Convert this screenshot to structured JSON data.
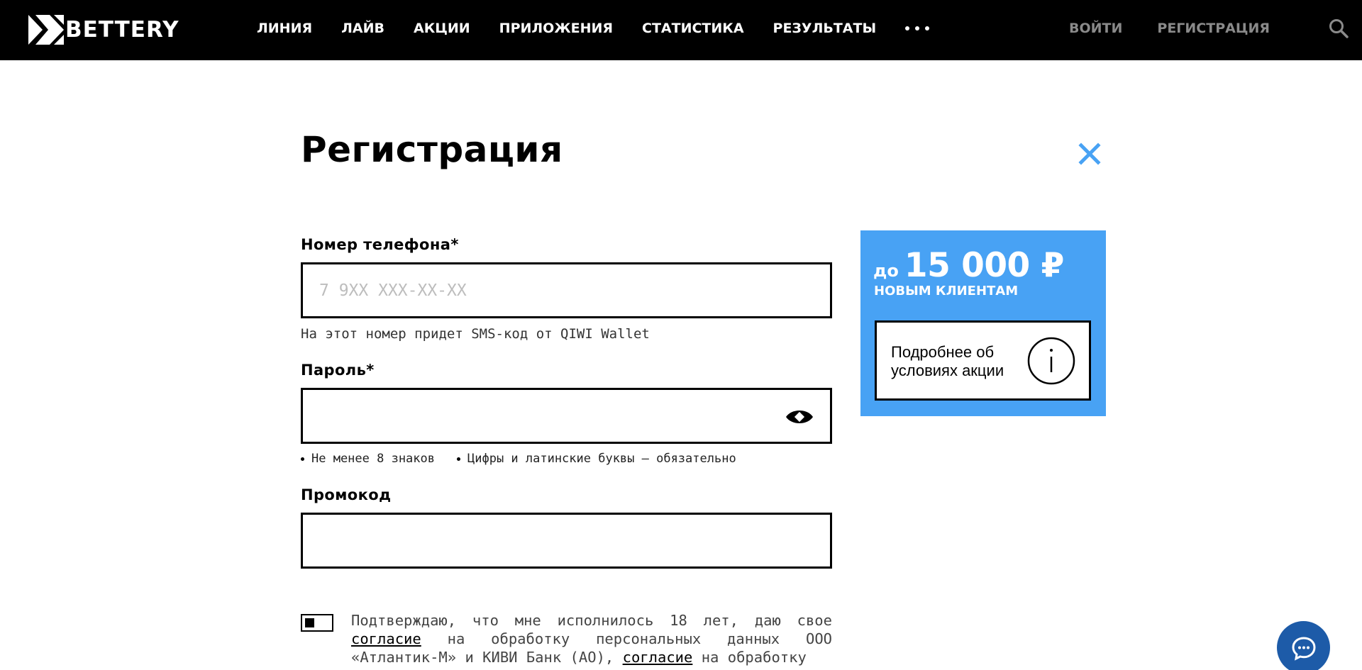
{
  "brand": {
    "name": "BETTERY"
  },
  "nav": {
    "items": [
      {
        "label": "ЛИНИЯ"
      },
      {
        "label": "ЛАЙВ"
      },
      {
        "label": "АКЦИИ"
      },
      {
        "label": "ПРИЛОЖЕНИЯ"
      },
      {
        "label": "СТАТИСТИКА"
      },
      {
        "label": "РЕЗУЛЬТАТЫ"
      }
    ],
    "more_icon": "more-dots-icon",
    "login": "ВОЙТИ",
    "register": "РЕГИСТРАЦИЯ",
    "search_icon": "search-icon"
  },
  "form": {
    "title": "Регистрация",
    "close_icon": "close-icon",
    "phone": {
      "label": "Номер телефона*",
      "placeholder": "7 9XX XXX-XX-XX",
      "value": "",
      "hint": "На этот номер придет SMS-код от QIWI Wallet"
    },
    "password": {
      "label": "Пароль*",
      "value": "",
      "rules": [
        "Не менее 8 знаков",
        "Цифры и латинские буквы – обязательно"
      ],
      "eye_icon": "eye-icon"
    },
    "promo": {
      "label": "Промокод",
      "value": ""
    },
    "consent": {
      "text_1": "Подтверждаю, что мне исполнилось 18 лет, даю свое ",
      "link_1": "согласие",
      "text_2": " на обработку персональных данных ООО «Атлантик-М» и КИВИ Банк (АО), ",
      "link_2": "согласие",
      "text_3": " на обработку"
    }
  },
  "promo_card": {
    "prefix": "до",
    "amount": "15 000 ₽",
    "subtitle": "НОВЫМ КЛИЕНТАМ",
    "more_label": "Подробнее об условиях акции",
    "info_icon": "info-icon"
  },
  "colors": {
    "accent": "#48a2f4",
    "topbar": "#000000",
    "chat": "#1d5ba8",
    "muted_link": "#8a8a8a"
  },
  "chat": {
    "icon": "chat-icon"
  }
}
